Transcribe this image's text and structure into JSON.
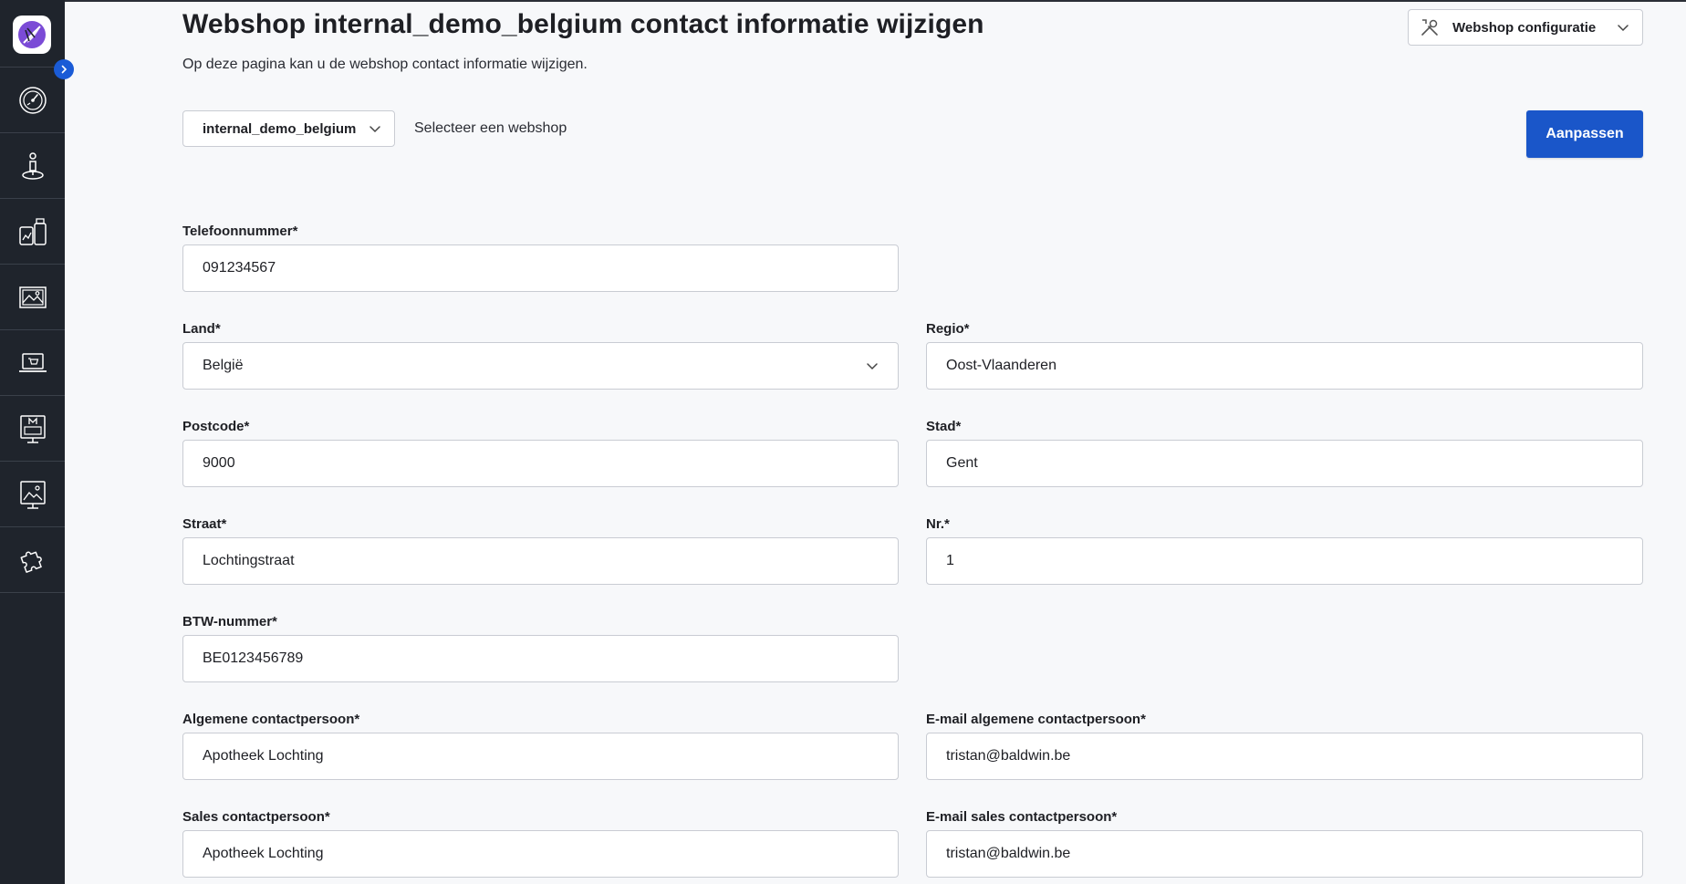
{
  "page": {
    "title": "Webshop internal_demo_belgium contact informatie wijzigen",
    "subtitle": "Op deze pagina kan u de webshop contact informatie wijzigen."
  },
  "header": {
    "config_dropdown": {
      "label": "Webshop configuratie",
      "icon": "wrench-screwdriver-icon"
    }
  },
  "webshop_select": {
    "selected": "internal_demo_belgium",
    "hint": "Selecteer een webshop"
  },
  "actions": {
    "save_label": "Aanpassen"
  },
  "sidebar": {
    "items": [
      {
        "icon": "dashboard-gauge-icon"
      },
      {
        "icon": "person-pin-icon"
      },
      {
        "icon": "products-stats-icon"
      },
      {
        "icon": "image-gallery-icon"
      },
      {
        "icon": "laptop-cart-icon"
      },
      {
        "icon": "monitor-m-icon"
      },
      {
        "icon": "display-image-icon"
      },
      {
        "icon": "puzzle-icon"
      }
    ]
  },
  "form": {
    "phone": {
      "label": "Telefoonnummer*",
      "value": "091234567"
    },
    "country": {
      "label": "Land*",
      "value": "België"
    },
    "region": {
      "label": "Regio*",
      "value": "Oost-Vlaanderen"
    },
    "postcode": {
      "label": "Postcode*",
      "value": "9000"
    },
    "city": {
      "label": "Stad*",
      "value": "Gent"
    },
    "street": {
      "label": "Straat*",
      "value": "Lochtingstraat"
    },
    "number": {
      "label": "Nr.*",
      "value": "1"
    },
    "vat": {
      "label": "BTW-nummer*",
      "value": "BE0123456789"
    },
    "general_contact": {
      "label": "Algemene contactpersoon*",
      "value": "Apotheek Lochting"
    },
    "general_email": {
      "label": "E-mail algemene contactpersoon*",
      "value": "tristan@baldwin.be"
    },
    "sales_contact": {
      "label": "Sales contactpersoon*",
      "value": "Apotheek Lochting"
    },
    "sales_email": {
      "label": "E-mail sales contactpersoon*",
      "value": "tristan@baldwin.be"
    }
  },
  "colors": {
    "sidebar_bg": "#1f242c",
    "accent": "#1a56c9",
    "page_bg": "#f7f8fa"
  }
}
